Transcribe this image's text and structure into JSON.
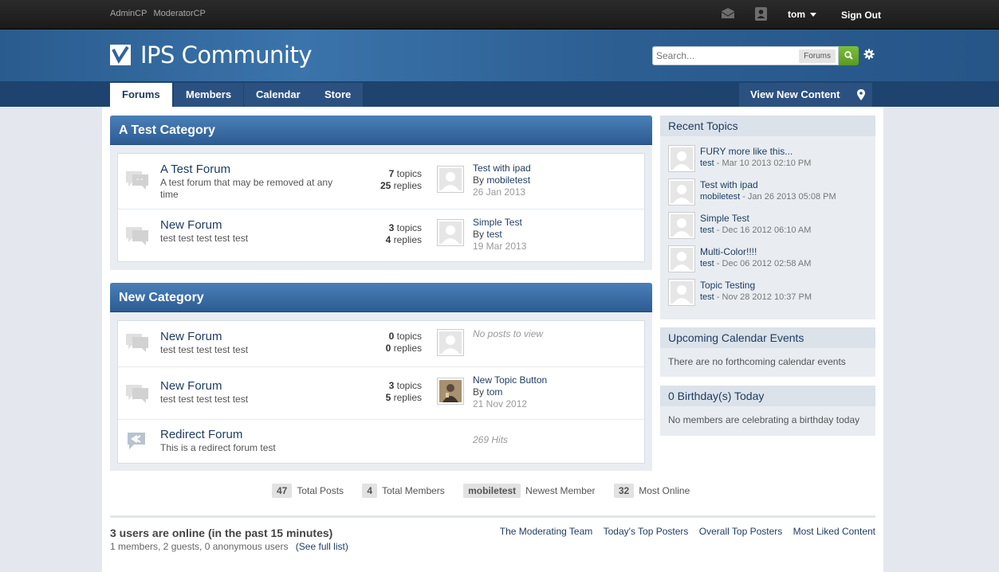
{
  "topbar": {
    "admin_links": [
      "AdminCP",
      "ModeratorCP"
    ],
    "user": "tom",
    "sign_out": "Sign Out"
  },
  "header": {
    "logo": "IPS Community",
    "search_placeholder": "Search...",
    "search_scope": "Forums"
  },
  "nav": {
    "tabs": [
      "Forums",
      "Members",
      "Calendar",
      "Store"
    ],
    "active_tab": "Forums",
    "view_new": "View New Content"
  },
  "categories": [
    {
      "title": "A Test Category",
      "forums": [
        {
          "title": "A Test Forum",
          "desc": "A test forum that may be removed at any time",
          "topics": "7",
          "replies": "25",
          "topics_label": "topics",
          "replies_label": "replies",
          "last_title": "Test with ipad",
          "by": "By",
          "last_user": "mobiletest",
          "last_date": "26 Jan 2013"
        },
        {
          "title": "New Forum",
          "desc": "test test test test test",
          "topics": "3",
          "replies": "4",
          "topics_label": "topics",
          "replies_label": "replies",
          "last_title": "Simple Test",
          "by": "By",
          "last_user": "test",
          "last_date": "19 Mar 2013"
        }
      ]
    },
    {
      "title": "New Category",
      "forums": [
        {
          "title": "New Forum",
          "desc": "test test test test test",
          "topics": "0",
          "replies": "0",
          "topics_label": "topics",
          "replies_label": "replies",
          "no_posts": "No posts to view"
        },
        {
          "title": "New Forum",
          "desc": "test test test test test",
          "topics": "3",
          "replies": "5",
          "topics_label": "topics",
          "replies_label": "replies",
          "last_title": "New Topic Button",
          "by": "By",
          "last_user": "tom",
          "last_date": "21 Nov 2012"
        },
        {
          "title": "Redirect Forum",
          "desc": "This is a redirect forum test",
          "hits": "269 Hits"
        }
      ]
    }
  ],
  "sidebar": {
    "recent_topics": {
      "title": "Recent Topics",
      "items": [
        {
          "title": "FURY more like this...",
          "user": "test",
          "date": "- Mar 10 2013 02:10 PM"
        },
        {
          "title": "Test with ipad",
          "user": "mobiletest",
          "date": "- Jan 26 2013 05:08 PM"
        },
        {
          "title": "Simple Test",
          "user": "test",
          "date": "- Dec 16 2012 06:10 AM"
        },
        {
          "title": "Multi-Color!!!!",
          "user": "test",
          "date": "- Dec 06 2012 02:58 AM"
        },
        {
          "title": "Topic Testing",
          "user": "test",
          "date": "- Nov 28 2012 10:37 PM"
        }
      ]
    },
    "calendar": {
      "title": "Upcoming Calendar Events",
      "text": "There are no forthcoming calendar events"
    },
    "birthdays": {
      "title": "0 Birthday(s) Today",
      "text": "No members are celebrating a birthday today"
    }
  },
  "stats": {
    "total_posts": {
      "value": "47",
      "label": "Total Posts"
    },
    "total_members": {
      "value": "4",
      "label": "Total Members"
    },
    "newest_member": {
      "value": "mobiletest",
      "label": "Newest Member"
    },
    "most_online": {
      "value": "32",
      "label": "Most Online"
    }
  },
  "online": {
    "title": "3 users are online (in the past 15 minutes)",
    "detail": "1 members, 2 guests, 0 anonymous users",
    "full_list": "(See full list)"
  },
  "footer_links": [
    "The Moderating Team",
    "Today's Top Posters",
    "Overall Top Posters",
    "Most Liked Content"
  ]
}
